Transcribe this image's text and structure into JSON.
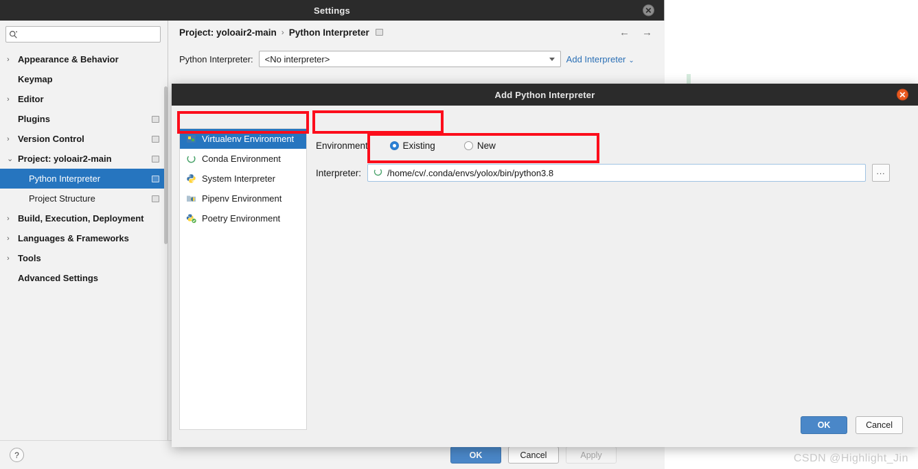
{
  "settings_window": {
    "title": "Settings",
    "close_icon": "close-icon",
    "search": {
      "value": "",
      "placeholder": "",
      "icon": "search-icon"
    },
    "sidebar": {
      "items": [
        {
          "label": "Appearance & Behavior",
          "arrow": "›",
          "level": 0,
          "selected": false,
          "tag": false
        },
        {
          "label": "Keymap",
          "arrow": "",
          "level": 0,
          "selected": false,
          "tag": false
        },
        {
          "label": "Editor",
          "arrow": "›",
          "level": 0,
          "selected": false,
          "tag": false
        },
        {
          "label": "Plugins",
          "arrow": "",
          "level": 0,
          "selected": false,
          "tag": true
        },
        {
          "label": "Version Control",
          "arrow": "›",
          "level": 0,
          "selected": false,
          "tag": true
        },
        {
          "label": "Project: yoloair2-main",
          "arrow": "⌄",
          "level": 0,
          "selected": false,
          "tag": true
        },
        {
          "label": "Python Interpreter",
          "arrow": "",
          "level": 1,
          "selected": true,
          "tag": true
        },
        {
          "label": "Project Structure",
          "arrow": "",
          "level": 1,
          "selected": false,
          "tag": true
        },
        {
          "label": "Build, Execution, Deployment",
          "arrow": "›",
          "level": 0,
          "selected": false,
          "tag": false
        },
        {
          "label": "Languages & Frameworks",
          "arrow": "›",
          "level": 0,
          "selected": false,
          "tag": false
        },
        {
          "label": "Tools",
          "arrow": "›",
          "level": 0,
          "selected": false,
          "tag": false
        },
        {
          "label": "Advanced Settings",
          "arrow": "",
          "level": 0,
          "selected": false,
          "tag": false
        }
      ]
    },
    "main": {
      "breadcrumb": {
        "project": "Project: yoloair2-main",
        "separator": "›",
        "page": "Python Interpreter"
      },
      "nav": {
        "back_icon": "arrow-left-icon",
        "forward_icon": "arrow-right-icon"
      },
      "interpreter_label": "Python Interpreter:",
      "interpreter_value": "<No interpreter>",
      "add_interpreter_label": "Add Interpreter",
      "add_interpreter_caret": "⌄"
    },
    "footer": {
      "help_label": "?",
      "ok_label": "OK",
      "cancel_label": "Cancel",
      "apply_label": "Apply"
    }
  },
  "dialog": {
    "title": "Add Python Interpreter",
    "close_icon": "close-icon",
    "env_list": [
      {
        "label": "Virtualenv Environment",
        "icon": "virtualenv-icon",
        "selected": true
      },
      {
        "label": "Conda Environment",
        "icon": "conda-icon",
        "selected": false
      },
      {
        "label": "System Interpreter",
        "icon": "python-icon",
        "selected": false
      },
      {
        "label": "Pipenv Environment",
        "icon": "pipenv-icon",
        "selected": false
      },
      {
        "label": "Poetry Environment",
        "icon": "poetry-icon",
        "selected": false
      }
    ],
    "environment_label": "Environment:",
    "radio_existing": "Existing",
    "radio_new": "New",
    "radio_selected": "Existing",
    "interpreter_label": "Interpreter:",
    "interpreter_path": "/home/cv/.conda/envs/yolox/bin/python3.8",
    "browse_label": "...",
    "ok_label": "OK",
    "cancel_label": "Cancel"
  },
  "background": {
    "hint_text": ""
  },
  "watermark": "CSDN @Highlight_Jin",
  "colors": {
    "accent_blue": "#2675bf",
    "button_blue": "#4a87c8",
    "annotation_red": "#fc0d1b",
    "titlebar_dark": "#2b2b2b",
    "close_orange": "#e8591f"
  }
}
